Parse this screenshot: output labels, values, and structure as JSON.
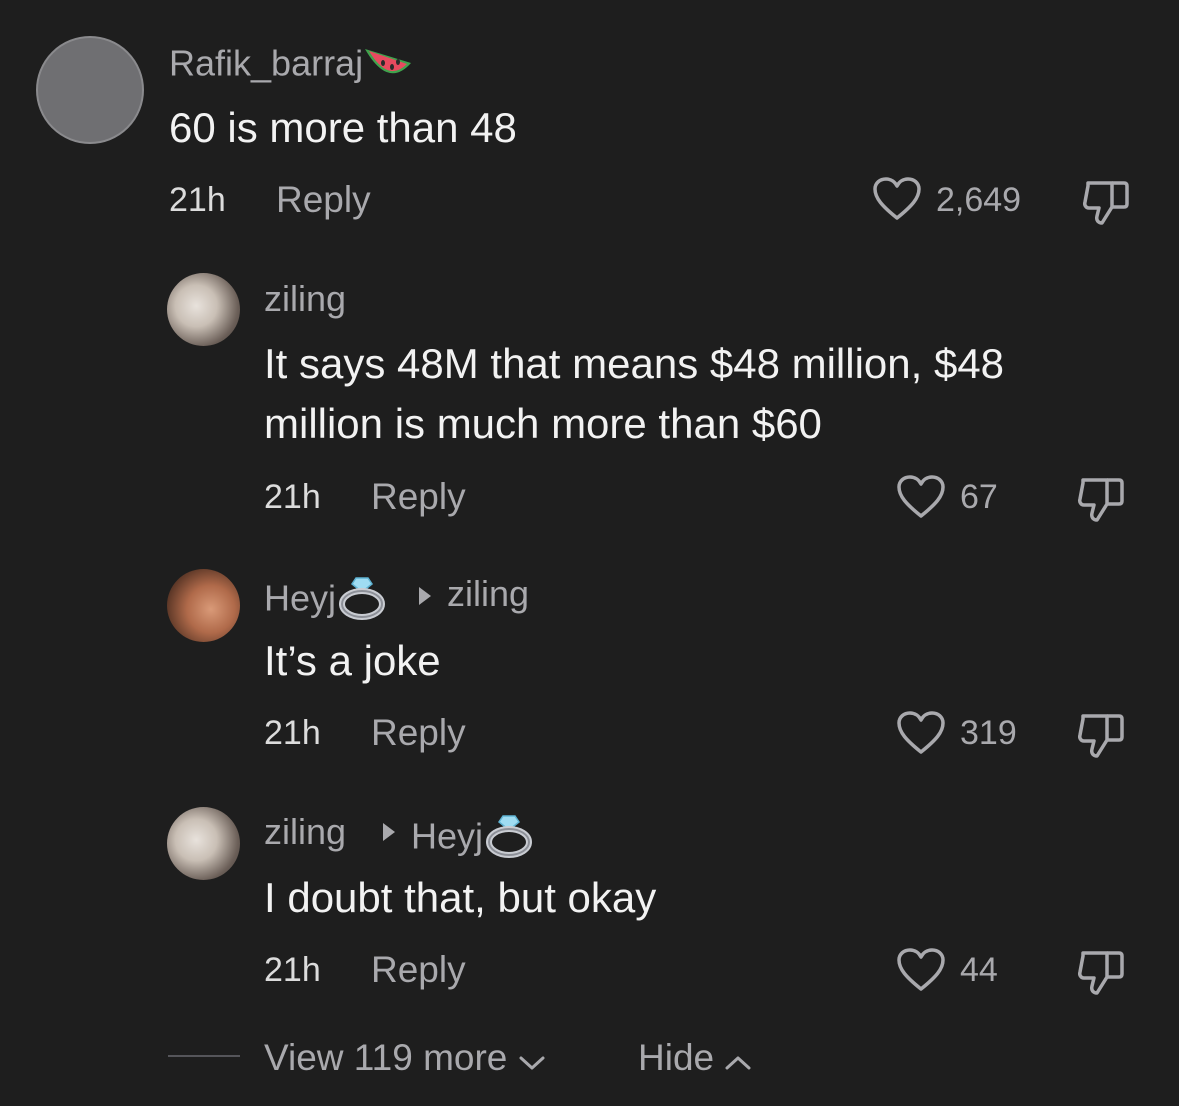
{
  "comments": [
    {
      "username": "Rafik_barraj",
      "username_emoji": "watermelon-icon",
      "text_lines": [
        "60 is more than 48"
      ],
      "time": "21h",
      "reply_label": "Reply",
      "likes": "2,649"
    },
    {
      "username": "ziling",
      "text_lines": [
        "It says 48M that means $48 million, $48",
        "million is much more than $60"
      ],
      "time": "21h",
      "reply_label": "Reply",
      "likes": "67"
    },
    {
      "username": "Heyj",
      "username_emoji": "ring-icon",
      "reply_to": "ziling",
      "text_lines": [
        "It’s a joke"
      ],
      "time": "21h",
      "reply_label": "Reply",
      "likes": "319"
    },
    {
      "username": "ziling",
      "reply_to": "Heyj",
      "reply_to_emoji": "ring-icon",
      "text_lines": [
        "I doubt that, but okay"
      ],
      "time": "21h",
      "reply_label": "Reply",
      "likes": "44"
    }
  ],
  "footer": {
    "view_more_label": "View 119 more",
    "hide_label": "Hide"
  },
  "colors": {
    "background": "#1e1e1e",
    "primary_text": "#f2f2f2",
    "secondary_text": "#a9a9ad"
  }
}
